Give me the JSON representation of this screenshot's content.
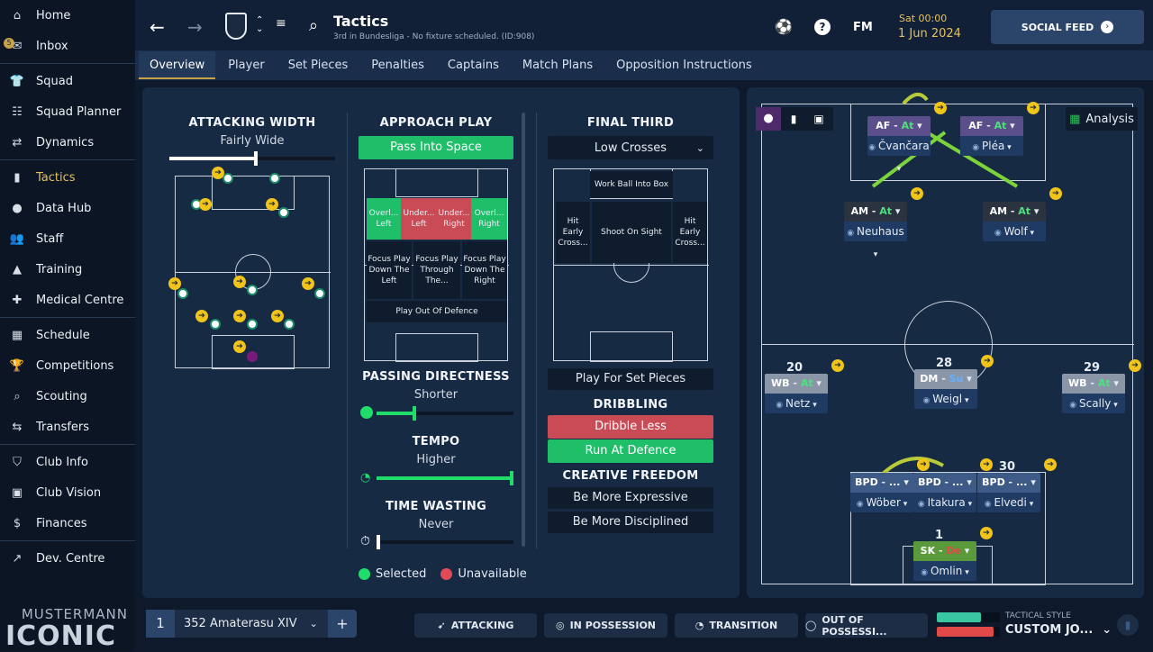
{
  "sidebar": {
    "items": [
      {
        "label": "Home",
        "icon": "home-icon",
        "glyph": "⌂"
      },
      {
        "label": "Inbox",
        "icon": "inbox-icon",
        "glyph": "✉"
      },
      {
        "label": "Squad",
        "icon": "shirt-icon",
        "glyph": "👕"
      },
      {
        "label": "Squad Planner",
        "icon": "clipboard-icon",
        "glyph": "☷"
      },
      {
        "label": "Dynamics",
        "icon": "dynamics-icon",
        "glyph": "⇄"
      },
      {
        "label": "Tactics",
        "icon": "tactics-board-icon",
        "glyph": "▮"
      },
      {
        "label": "Data Hub",
        "icon": "data-hub-icon",
        "glyph": "●"
      },
      {
        "label": "Staff",
        "icon": "staff-icon",
        "glyph": "👥"
      },
      {
        "label": "Training",
        "icon": "training-cone-icon",
        "glyph": "▲"
      },
      {
        "label": "Medical Centre",
        "icon": "medical-icon",
        "glyph": "✚"
      },
      {
        "label": "Schedule",
        "icon": "calendar-icon",
        "glyph": "▦"
      },
      {
        "label": "Competitions",
        "icon": "trophy-icon",
        "glyph": "🏆"
      },
      {
        "label": "Scouting",
        "icon": "search-icon",
        "glyph": "⌕"
      },
      {
        "label": "Transfers",
        "icon": "transfer-icon",
        "glyph": "⇆"
      },
      {
        "label": "Club Info",
        "icon": "shield-icon",
        "glyph": "⛉"
      },
      {
        "label": "Club Vision",
        "icon": "briefcase-icon",
        "glyph": "▣"
      },
      {
        "label": "Finances",
        "icon": "money-icon",
        "glyph": "$"
      },
      {
        "label": "Dev. Centre",
        "icon": "dev-centre-icon",
        "glyph": "↗"
      }
    ],
    "inbox_badge": "5",
    "brand_top": "MUSTERMANN",
    "brand_bottom": "ICONIC"
  },
  "header": {
    "title": "Tactics",
    "subtitle": "3rd in Bundesliga - No fixture scheduled. (ID:908)",
    "date_day": "Sat 00:00",
    "date_full": "1 Jun 2024",
    "fm_label": "FM",
    "social_feed": "SOCIAL FEED"
  },
  "tabs": [
    "Overview",
    "Player",
    "Set Pieces",
    "Penalties",
    "Captains",
    "Match Plans",
    "Opposition Instructions"
  ],
  "left": {
    "attacking_width": {
      "title": "ATTACKING WIDTH",
      "value": "Fairly Wide",
      "level": 0.52
    },
    "approach": {
      "title": "APPROACH PLAY",
      "value": "Pass Into Space"
    },
    "approach_zones": {
      "top": [
        "Overl... Left",
        "Under... Left",
        "Under... Right",
        "Overl... Right"
      ],
      "mid": [
        "Focus Play Down The Left",
        "Focus Play Through The...",
        "Focus Play Down The Right"
      ],
      "bottom": "Play Out Of Defence"
    },
    "passing": {
      "title": "PASSING DIRECTNESS",
      "value": "Shorter",
      "level": 0.27
    },
    "tempo": {
      "title": "TEMPO",
      "value": "Higher",
      "level": 1.0
    },
    "time_wasting": {
      "title": "TIME WASTING",
      "value": "Never",
      "level": 0.0
    },
    "final_third": {
      "title": "FINAL THIRD",
      "value": "Low Crosses"
    },
    "final_zones": {
      "top": "Work Ball Into Box",
      "left": "Hit Early Cross...",
      "center": "Shoot On Sight",
      "right": "Hit Early Cross..."
    },
    "set_pieces": "Play For Set Pieces",
    "dribbling": {
      "title": "DRIBBLING",
      "less": "Dribble Less",
      "run": "Run At Defence"
    },
    "creative": {
      "title": "CREATIVE FREEDOM",
      "a": "Be More Expressive",
      "b": "Be More Disciplined"
    },
    "legend": {
      "selected": "Selected",
      "unavailable": "Unavailable"
    }
  },
  "right": {
    "analysis": "Analysis",
    "players": [
      {
        "role": "AF",
        "duty": "At",
        "name": "Čvančara"
      },
      {
        "role": "AF",
        "duty": "At",
        "name": "Pléa"
      },
      {
        "role": "AM",
        "duty": "At",
        "name": "Neuhaus"
      },
      {
        "role": "AM",
        "duty": "At",
        "name": "Wolf"
      },
      {
        "role": "WB",
        "duty": "At",
        "name": "Netz",
        "num": "20"
      },
      {
        "role": "DM",
        "duty": "Su",
        "name": "Weigl",
        "num": "28"
      },
      {
        "role": "WB",
        "duty": "At",
        "name": "Scally",
        "num": "29"
      },
      {
        "role": "BPD",
        "duty": "...",
        "name": "Wöber"
      },
      {
        "role": "BPD",
        "duty": "...",
        "name": "Itakura"
      },
      {
        "role": "BPD",
        "duty": "...",
        "name": "Elvedi",
        "num": "30"
      },
      {
        "role": "SK",
        "duty": "De",
        "name": "Omlin",
        "num": "1"
      }
    ]
  },
  "bottom": {
    "tactic_no": "1",
    "tactic_name": "352 Amaterasu XIV",
    "add": "+",
    "attacking": "ATTACKING",
    "in_possession": "IN POSSESSION",
    "transition": "TRANSITION",
    "out_possession": "OUT OF POSSESSI...",
    "style_label": "TACTICAL STYLE",
    "style_value": "CUSTOM JO...",
    "bar_plus": 0.7,
    "bar_minus": 0.9
  },
  "colors": {
    "green": "#1fbf6a",
    "red": "#c94b55",
    "accent": "#c8a24a",
    "at": "#4ee07c",
    "su": "#5fb2ff",
    "de": "#e24a4a"
  }
}
